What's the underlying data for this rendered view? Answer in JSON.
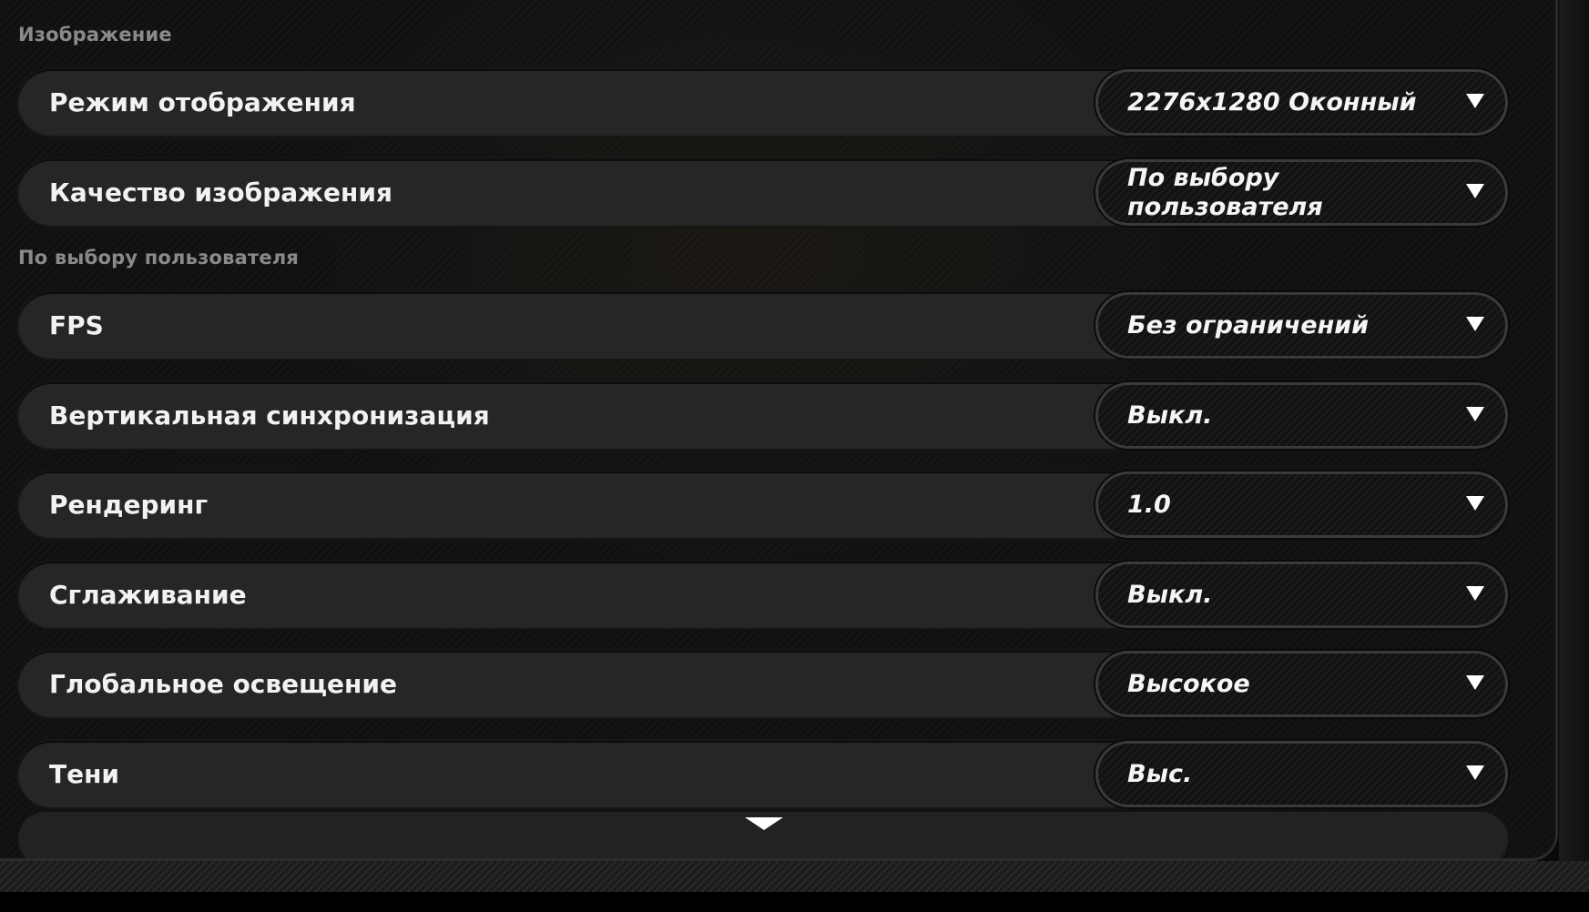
{
  "sections": {
    "image_label": "Изображение",
    "custom_label": "По выбору пользователя"
  },
  "rows": [
    {
      "label": "Режим отображения",
      "value": "2276x1280 Оконный"
    },
    {
      "label": "Качество изображения",
      "value": "По выбору пользователя"
    },
    {
      "label": "FPS",
      "value": "Без ограничений"
    },
    {
      "label": "Вертикальная синхронизация",
      "value": "Выкл."
    },
    {
      "label": "Рендеринг",
      "value": "1.0"
    },
    {
      "label": "Сглаживание",
      "value": "Выкл."
    },
    {
      "label": "Глобальное освещение",
      "value": "Высокое"
    },
    {
      "label": "Тени",
      "value": "Выс."
    }
  ],
  "icons": {
    "dropdown": "chevron-down-icon",
    "scroll_more": "scroll-down-indicator-icon"
  },
  "colors": {
    "row_bg": "#262626",
    "text": "#f2f2f2",
    "section_label": "#8a8a8a",
    "select_border": "#3a3a3a"
  }
}
